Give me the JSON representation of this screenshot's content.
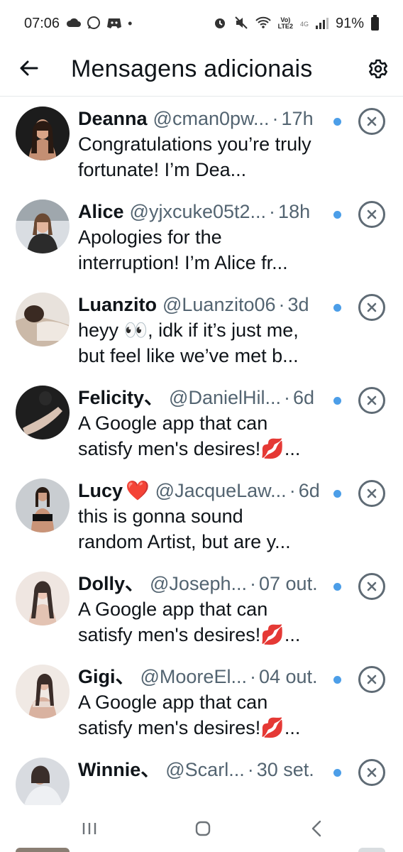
{
  "status_bar": {
    "time": "07:06",
    "network_top": "Vo)",
    "network_bottom": "LTE2",
    "network_gen": "4G",
    "battery": "91%"
  },
  "header": {
    "title": "Mensagens adicionais",
    "back_icon": "back-arrow-icon",
    "settings_icon": "gear-icon"
  },
  "messages": [
    {
      "name": "Deanna",
      "handle": "@cman0pw...",
      "time": "17h",
      "snippet": "Congratulations you’re truly fortunate! I’m Dea...",
      "unread": true,
      "heart": ""
    },
    {
      "name": "Alice",
      "handle": "@yjxcuke05t2...",
      "time": "18h",
      "snippet": "Apologies for the interruption! I’m Alice fr...",
      "unread": true,
      "heart": ""
    },
    {
      "name": "Luanzito",
      "handle": "@Luanzito06",
      "time": "3d",
      "snippet": "heyy 👀, idk if it’s just me, but feel like we’ve met b...",
      "unread": true,
      "heart": ""
    },
    {
      "name": "Felicity、",
      "handle": "@DanielHil...",
      "time": "6d",
      "snippet": "A Google app that can satisfy men's desires!💋...",
      "unread": true,
      "heart": ""
    },
    {
      "name": "Lucy",
      "handle": "@JacqueLaw...",
      "time": "6d",
      "snippet": "this is gonna sound random Artist, but are y...",
      "unread": true,
      "heart": "❤️"
    },
    {
      "name": "Dolly、",
      "handle": "@Joseph...",
      "time": "07 out.",
      "snippet": "A Google app that can satisfy men's desires!💋...",
      "unread": true,
      "heart": ""
    },
    {
      "name": "Gigi、",
      "handle": "@MooreEl...",
      "time": "04 out.",
      "snippet": "A Google app that can satisfy men's desires!💋...",
      "unread": true,
      "heart": ""
    },
    {
      "name": "Winnie、",
      "handle": "@Scarl...",
      "time": "30 set.",
      "snippet": "",
      "unread": true,
      "heart": ""
    }
  ],
  "colors": {
    "unread_dot": "#4c9ee8",
    "secondary_text": "#536471",
    "primary_text": "#0f1419"
  },
  "navbar": {
    "recents_icon": "recents-icon",
    "home_icon": "home-icon",
    "back_icon": "nav-back-icon"
  }
}
